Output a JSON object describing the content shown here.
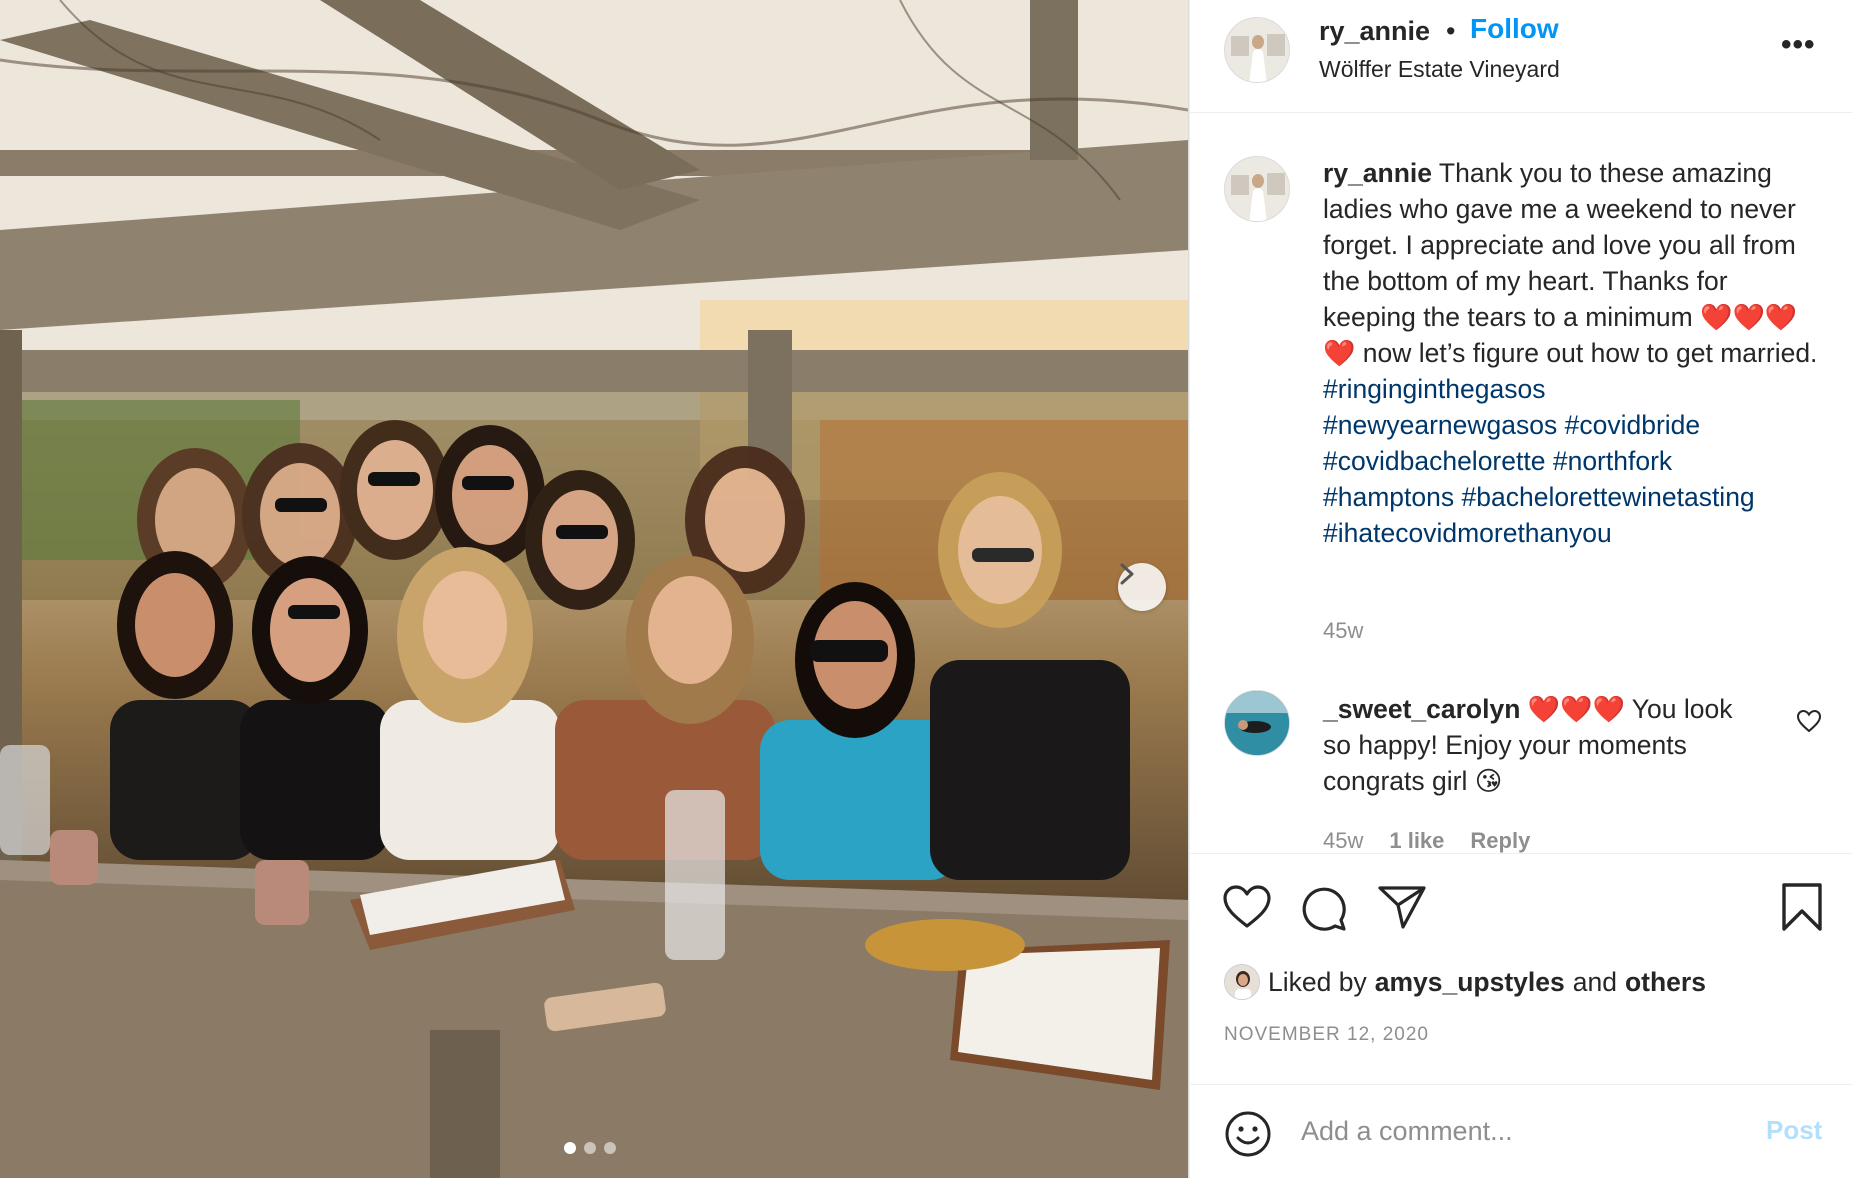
{
  "post": {
    "photo_alt": "Group photo of eleven women at an outdoor wooden table under a vineyard pergola at sunset",
    "carousel": {
      "current": 1,
      "total": 3
    }
  },
  "header": {
    "username": "ry_annie",
    "separator": "•",
    "follow_label": "Follow",
    "location": "Wölffer Estate Vineyard",
    "more_label": "•••"
  },
  "caption": {
    "username": "ry_annie",
    "text_part1": "Thank you to these amazing ladies who gave me a weekend to never forget. I appreciate and love you all from the bottom of my heart. Thanks for keeping the tears to a minimum",
    "hearts": "❤️❤️❤️❤️",
    "text_part2": "now let’s figure out how to get married.",
    "hashtags": [
      "#ringinginthegasos",
      "#newyearnewgasos",
      "#covidbride",
      "#covidbachelorette",
      "#northfork",
      "#hamptons",
      "#bachelorettewinetasting",
      "#ihatecovidmorethanyou"
    ],
    "time": "45w"
  },
  "comments": [
    {
      "username": "_sweet_carolyn",
      "hearts": "❤️❤️❤️",
      "text": "You look so happy! Enjoy your moments congrats girl",
      "emoji": "😘",
      "time": "45w",
      "likes": "1 like",
      "reply_label": "Reply"
    }
  ],
  "likes": {
    "prefix": "Liked by",
    "user": "amys_upstyles",
    "and": "and",
    "others": "others"
  },
  "date": "NOVEMBER 12, 2020",
  "add_comment": {
    "placeholder": "Add a comment...",
    "post_label": "Post"
  },
  "colors": {
    "accent": "#0095f6",
    "hashtag": "#00376b",
    "muted": "#8e8e8e",
    "post_disabled": "#b2dffc"
  }
}
